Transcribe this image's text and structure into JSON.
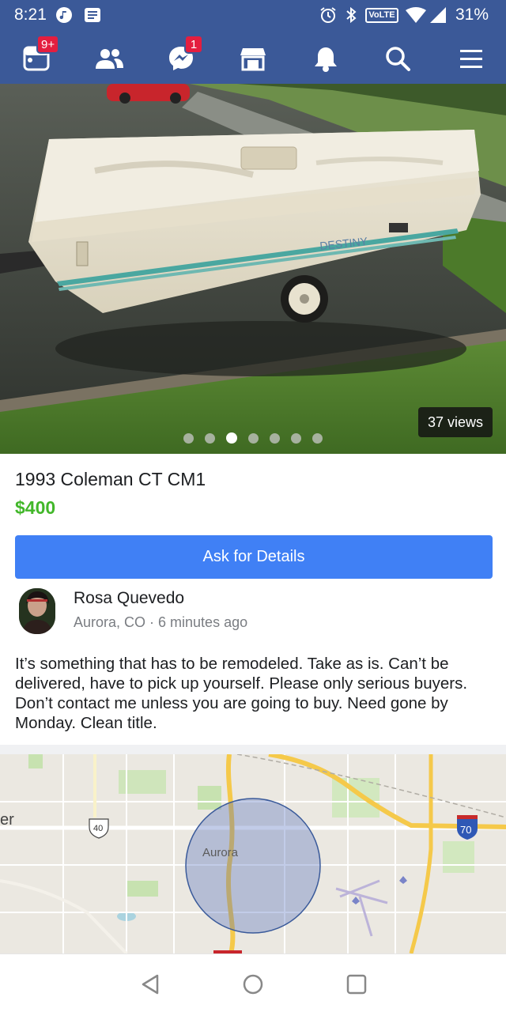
{
  "status_bar": {
    "time": "8:21",
    "network_badge": "VoLTE",
    "battery": "31%"
  },
  "nav": {
    "items": [
      {
        "name": "feed-icon",
        "badge": "9+"
      },
      {
        "name": "friends-icon",
        "badge": ""
      },
      {
        "name": "messenger-icon",
        "badge": "1"
      },
      {
        "name": "marketplace-icon",
        "badge": ""
      },
      {
        "name": "notifications-icon",
        "badge": ""
      },
      {
        "name": "search-icon",
        "badge": ""
      },
      {
        "name": "menu-icon",
        "badge": ""
      }
    ],
    "accent": "#3b5998",
    "badge_color": "#e41e3f"
  },
  "photo": {
    "views": "37 views",
    "camper_brand": "DESTINY",
    "dots_total": 7,
    "dots_active_index": 2
  },
  "listing": {
    "title": "1993 Coleman CT CM1",
    "price": "$400",
    "price_color": "#42b72a",
    "ask_button": "Ask for Details",
    "ask_button_color": "#4080f5"
  },
  "seller": {
    "name": "Rosa Quevedo",
    "meta": "Aurora, CO · 6 minutes ago"
  },
  "description": "It’s something that has to be remodeled. Take as is. Can’t be delivered, have to pick up yourself. Please only serious buyers. Don’t contact me unless you are going to buy. Need gone by Monday. Clean title.",
  "map": {
    "city_label": "Aurora",
    "edge_label": "er",
    "route_us": "40",
    "route_interstate": "70"
  },
  "android_nav": [
    "back-icon",
    "home-icon",
    "recents-icon"
  ]
}
